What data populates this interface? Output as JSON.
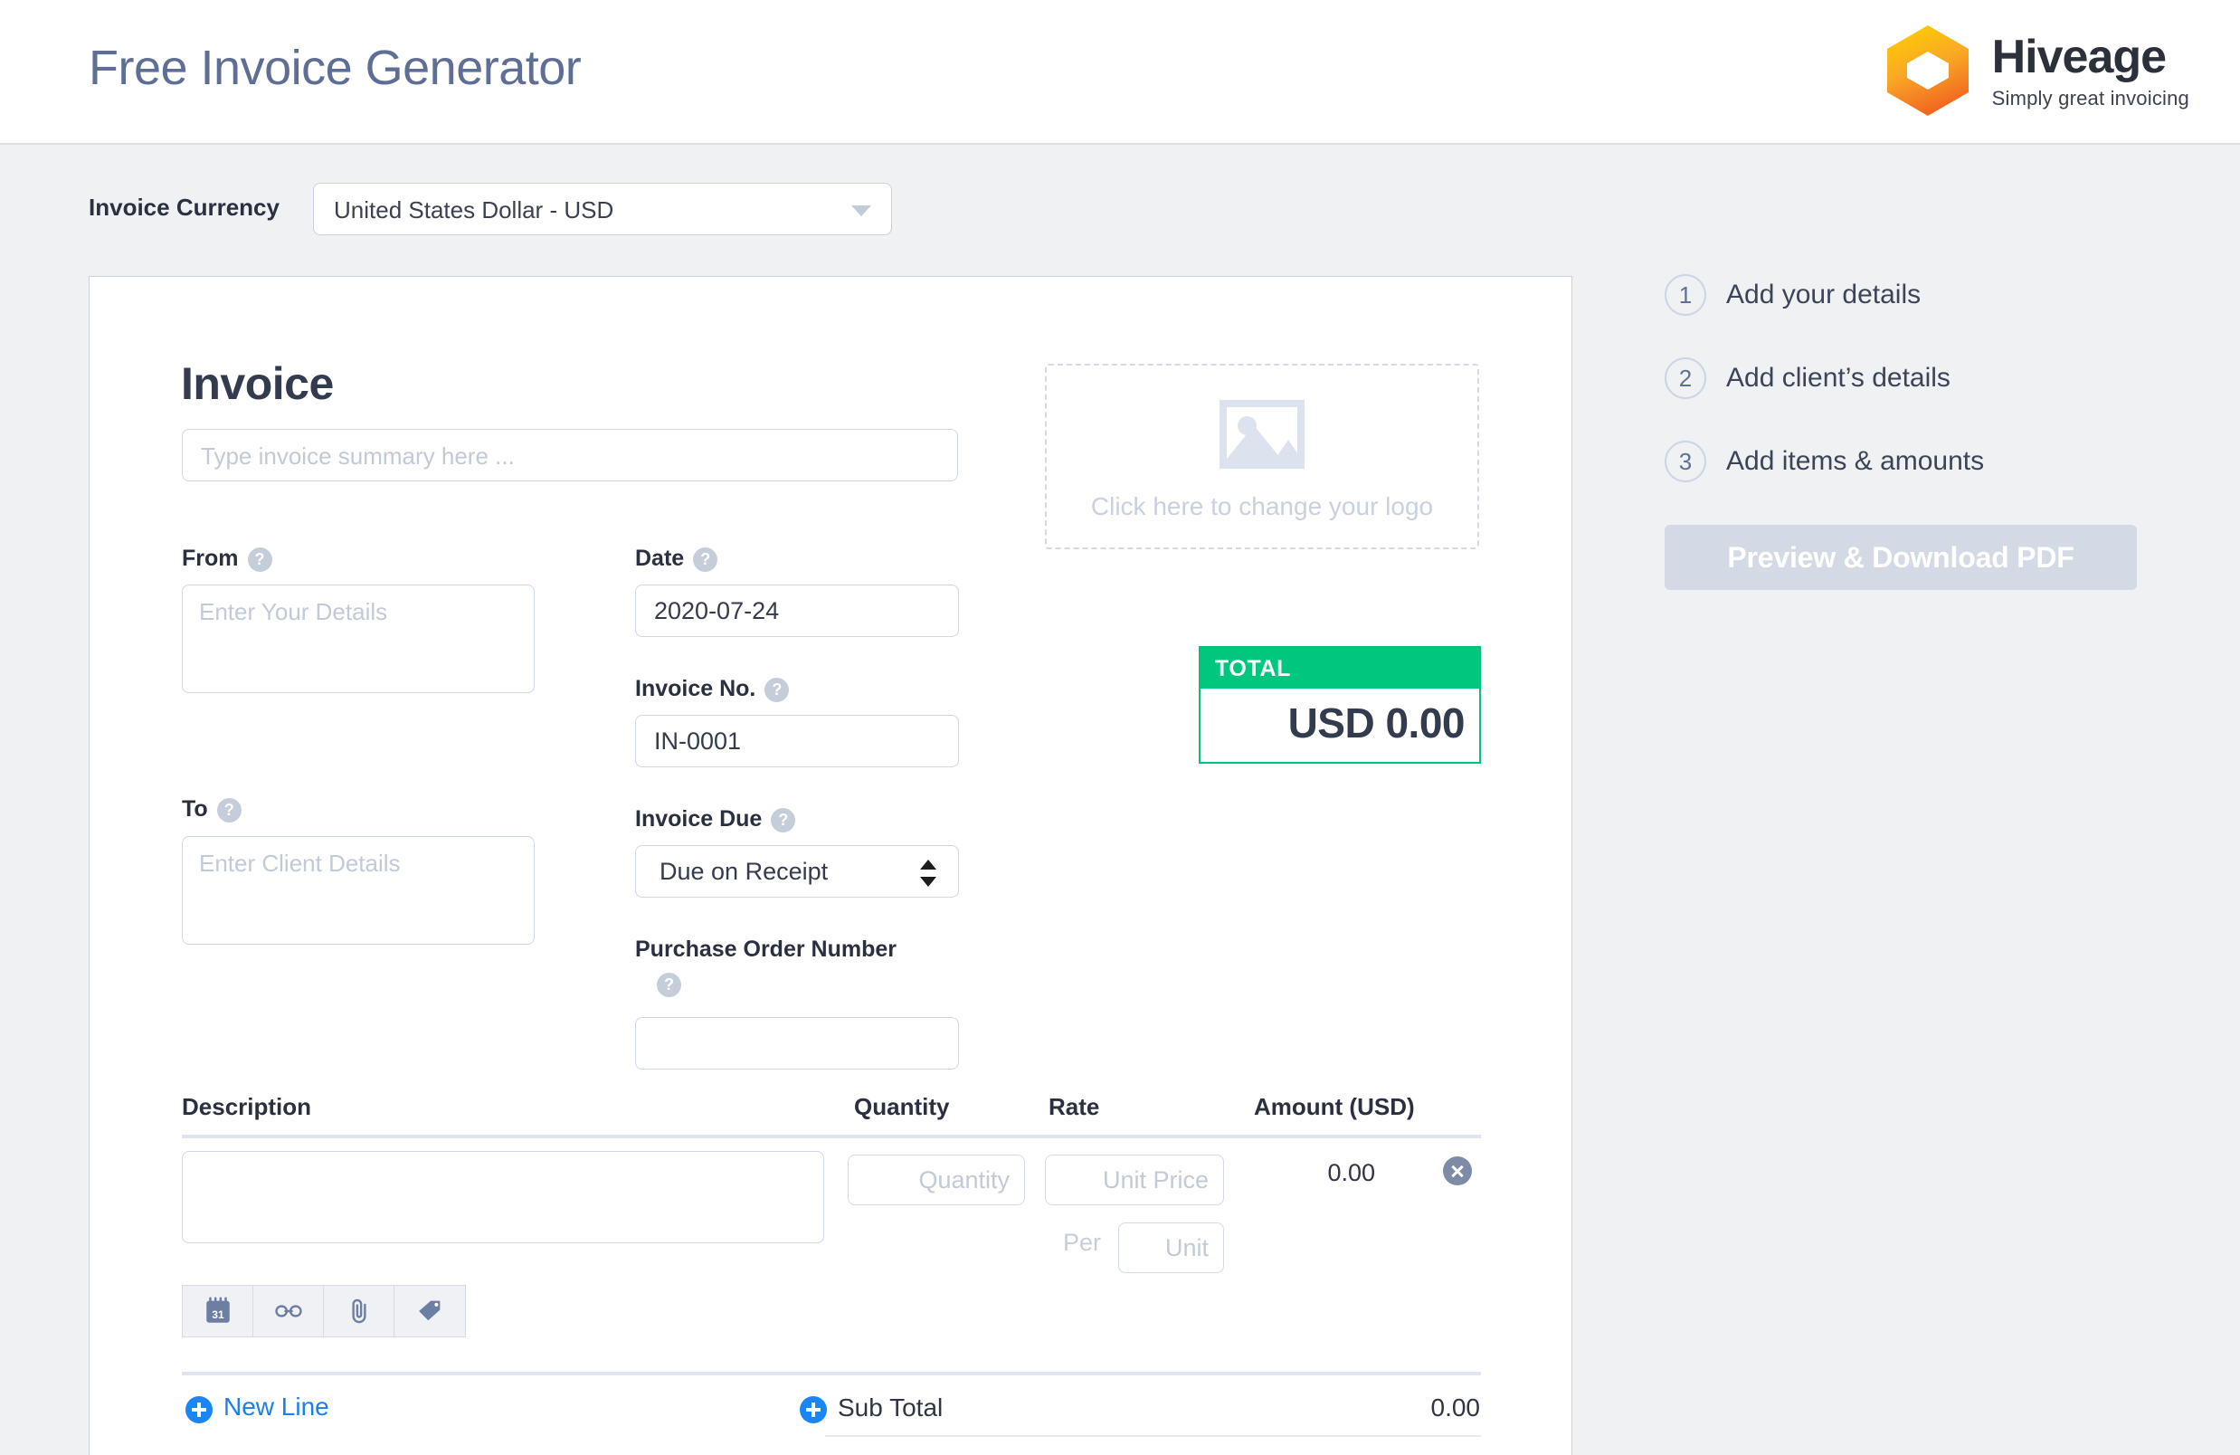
{
  "header": {
    "title": "Free Invoice Generator",
    "brand_name": "Hiveage",
    "brand_tagline": "Simply great invoicing"
  },
  "currency": {
    "label": "Invoice Currency",
    "selected": "United States Dollar - USD"
  },
  "invoice": {
    "heading": "Invoice",
    "summary_placeholder": "Type invoice summary here ...",
    "from_label": "From",
    "from_placeholder": "Enter Your Details",
    "from_value": "",
    "to_label": "To",
    "to_placeholder": "Enter Client Details",
    "to_value": "",
    "date_label": "Date",
    "date_value": "2020-07-24",
    "invoice_no_label": "Invoice No.",
    "invoice_no_value": "IN-0001",
    "due_label": "Invoice Due",
    "due_value": "Due on Receipt",
    "po_label": "Purchase Order Number",
    "po_value": "",
    "help_glyph": "?"
  },
  "logo": {
    "caption": "Click here to change your logo"
  },
  "total": {
    "label": "TOTAL",
    "amount": "USD 0.00",
    "accent_color": "#00c77d"
  },
  "items": {
    "columns": {
      "description": "Description",
      "quantity": "Quantity",
      "rate": "Rate",
      "amount": "Amount (USD)"
    },
    "rows": [
      {
        "description": "",
        "quantity_placeholder": "Quantity",
        "rate_placeholder": "Unit Price",
        "per_label": "Per",
        "unit_placeholder": "Unit",
        "amount": "0.00"
      }
    ],
    "tools": [
      "calendar-31-icon",
      "link-icon",
      "paperclip-icon",
      "tag-icon"
    ],
    "calendar_day": "31"
  },
  "footer": {
    "new_line": "New Line",
    "sub_total_label": "Sub Total",
    "sub_total_value": "0.00"
  },
  "steps": [
    {
      "num": "1",
      "label": "Add your details"
    },
    {
      "num": "2",
      "label": "Add client’s details"
    },
    {
      "num": "3",
      "label": "Add items & amounts"
    }
  ],
  "actions": {
    "pdf_button": "Preview & Download PDF"
  }
}
